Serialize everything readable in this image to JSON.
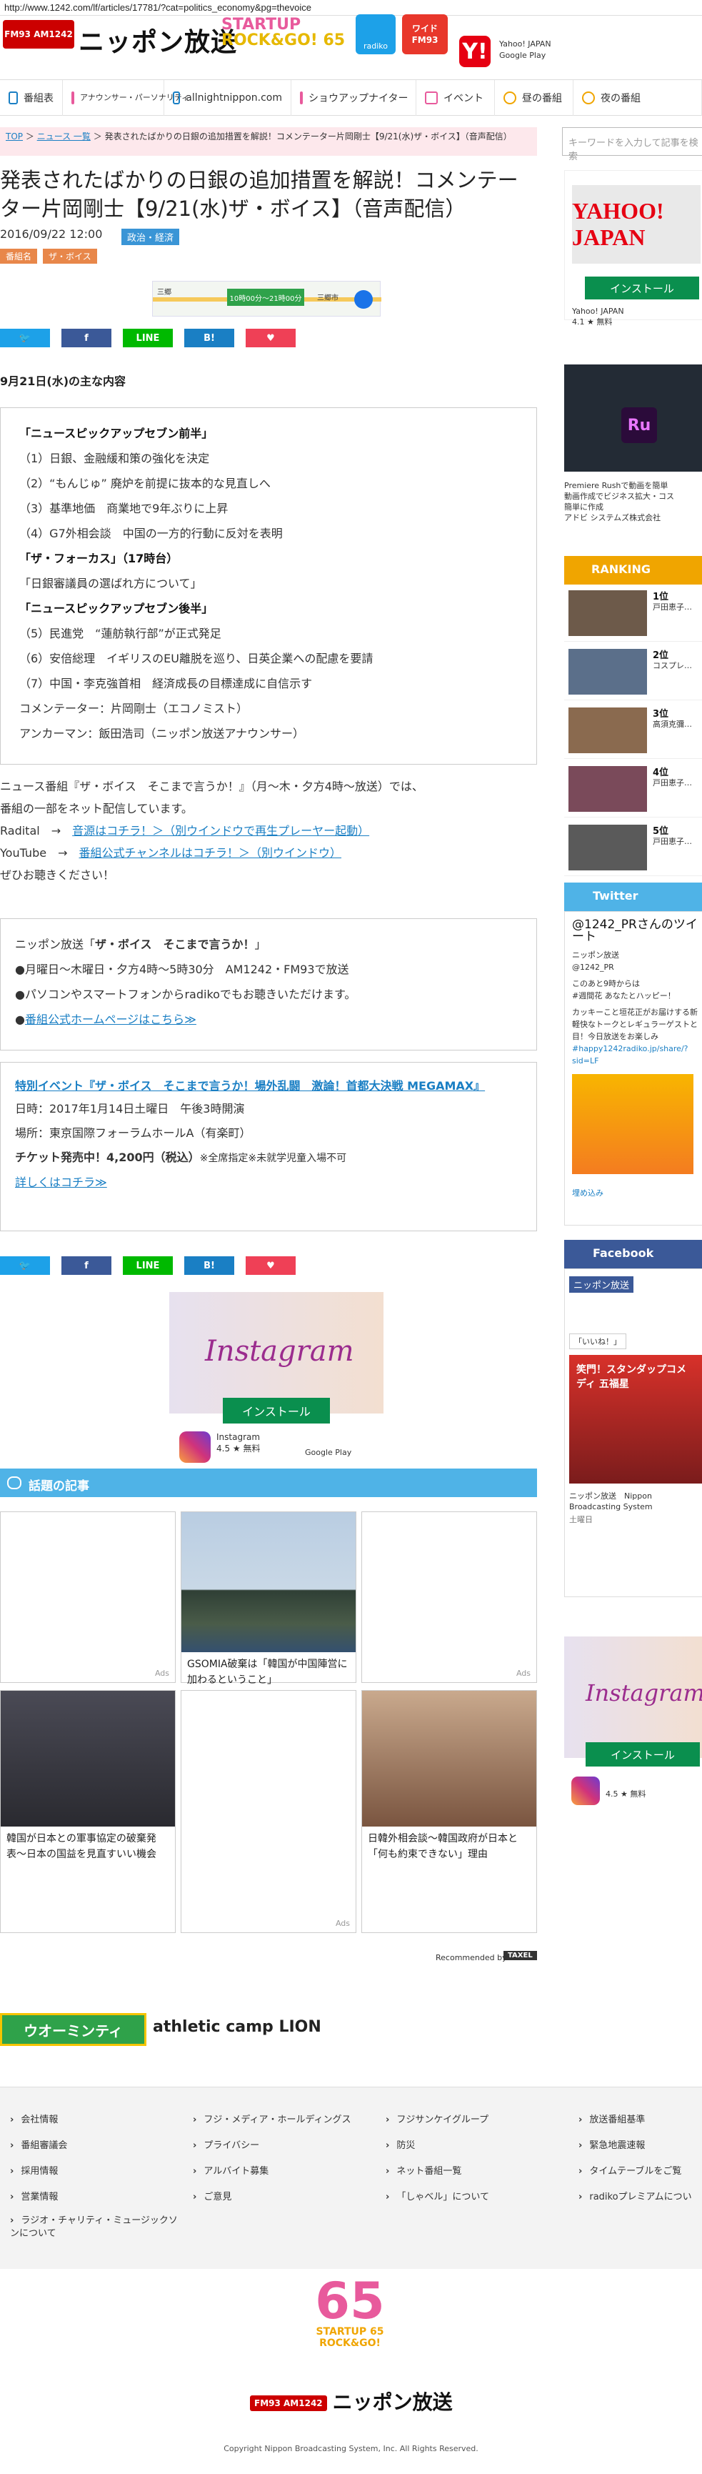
{
  "url": "http://www.1242.com/lf/articles/17781/?cat=politics_economy&pg=thevoice",
  "header": {
    "logo_mark": "FM93 AM1242",
    "logo_text": "ニッポン放送",
    "startup_line1": "STARTUP",
    "startup_line2": "ROCK&GO! 65",
    "radiko_label": "radiko",
    "wide_line1": "ワイド",
    "wide_line2": "FM93",
    "yahoo_app": "Yahoo! JAPAN",
    "yahoo_store": "Google Play",
    "yahoo_icon": "Y!"
  },
  "nav": [
    {
      "label": "番組表"
    },
    {
      "label": "アナウンサー・パーソナリティ"
    },
    {
      "label": "allnightnippon.com"
    },
    {
      "label": "ショウアップナイター"
    },
    {
      "label": "イベント"
    },
    {
      "label": "昼の番組"
    },
    {
      "label": "夜の番組"
    }
  ],
  "breadcrumb": {
    "top": "TOP",
    "sep": "＞",
    "news": "ニュース 一覧",
    "current": "発表されたばかりの日銀の追加措置を解説！コメンテーター片岡剛士【9/21(水)ザ・ボイス】（音声配信）"
  },
  "search": {
    "placeholder": "キーワードを入力して記事を検索"
  },
  "article": {
    "title": "発表されたばかりの日銀の追加措置を解説！コメンテーター片岡剛士【9/21(水)ザ・ボイス】（音声配信）",
    "date": "2016/09/22 12:00",
    "category": "政治・経済",
    "tag_label": "番組名",
    "tag_value": "ザ・ボイス",
    "map_ad_text": "10時00分〜21時00分",
    "map_ad_place1": "三郷",
    "map_ad_place2": "三郷市"
  },
  "share": {
    "twitter": "🐦",
    "facebook": "f",
    "line": "LINE",
    "hatena": "B!",
    "pocket": "♥"
  },
  "content": {
    "heading": "9月21日(水)の主な内容",
    "lines": [
      {
        "text": "「ニュースピックアップセブン前半」",
        "bold": true
      },
      {
        "text": "（1）日銀、金融緩和策の強化を決定",
        "bold": false
      },
      {
        "text": "（2）“もんじゅ” 廃炉を前提に抜本的な見直しへ",
        "bold": false
      },
      {
        "text": "（3）基準地価　商業地で9年ぶりに上昇",
        "bold": false
      },
      {
        "text": "（4）G7外相会談　中国の一方的行動に反対を表明",
        "bold": false
      },
      {
        "text": "「ザ・フォーカス」（17時台）",
        "bold": true
      },
      {
        "text": "「日銀審議員の選ばれ方について」",
        "bold": false
      },
      {
        "text": "「ニュースピックアップセブン後半」",
        "bold": true
      },
      {
        "text": "（5）民進党　“蓮舫執行部”が正式発足",
        "bold": false
      },
      {
        "text": "（6）安倍総理　イギリスのEU離脱を巡り、日英企業への配慮を要請",
        "bold": false
      },
      {
        "text": "（7）中国・李克強首相　経済成長の目標達成に自信示す",
        "bold": false
      },
      {
        "text": "コメンテーター：片岡剛士（エコノミスト）",
        "bold": false
      },
      {
        "text": "アンカーマン：飯田浩司（ニッポン放送アナウンサー）",
        "bold": false
      }
    ]
  },
  "description": {
    "line1": "ニュース番組『ザ・ボイス　そこまで言うか！』（月〜木・夕方4時〜放送）では、",
    "line2": "番組の一部をネット配信しています。",
    "radital_label": "Radital　→　",
    "radital_link": "音源はコチラ！＞（別ウインドウで再生プレーヤー起動）",
    "youtube_label": "YouTube　→　",
    "youtube_link": "番組公式チャンネルはコチラ！＞（別ウインドウ）",
    "closing": "ぜひお聴きください！"
  },
  "program_box": {
    "line1_prefix": "ニッポン放送「",
    "line1_bold": "ザ・ボイス　そこまで言うか！",
    "line1_suffix": "」",
    "line2": "●月曜日〜木曜日・夕方4時〜5時30分　AM1242・FM93で放送",
    "line3": "●パソコンやスマートフォンからradikoでもお聴きいただけます。",
    "line4_prefix": "●",
    "line4_link": "番組公式ホームページはこちら≫"
  },
  "event_box": {
    "title": "特別イベント『ザ・ボイス　そこまで言うか！場外乱闘　激論！首都大決戦 MEGAMAX』",
    "date": "日時：2017年1月14日土曜日　午後3時開演",
    "place": "場所：東京国際フォーラムホールA（有楽町）",
    "ticket_bold": "チケット発売中！4,200円（税込）",
    "ticket_rest": "※全席指定※未就学児童入場不可",
    "link": "詳しくはコチラ≫"
  },
  "insta_ad": {
    "logo": "Instagram",
    "install": "インストール",
    "name": "Instagram",
    "rating": "4.5 ★ 無料",
    "store": "Google Play"
  },
  "related": {
    "heading": "話題の記事",
    "cards": [
      {
        "caption": "",
        "ads": "Ads"
      },
      {
        "caption": "GSOMIA破棄は「韓国が中国陣営に加わるということ」",
        "ads": ""
      },
      {
        "caption": "",
        "ads": "Ads"
      },
      {
        "caption": "韓国が日本との軍事協定の破棄発表〜日本の国益を見直すいい機会",
        "ads": ""
      },
      {
        "caption": "",
        "ads": "Ads"
      },
      {
        "caption": "日韓外相会談〜韓国政府が日本と「何も約束できない」理由",
        "ads": ""
      }
    ],
    "recommended_by": "Recommended by",
    "taxel": "TAXEL"
  },
  "footer_banners": {
    "banner1": "ウオーミンティ",
    "banner2": "athletic camp LION"
  },
  "footer_links": {
    "col1": [
      "会社情報",
      "番組審議会",
      "採用情報",
      "営業情報",
      "ラジオ・チャリティ・ミュージックソンについて"
    ],
    "col2": [
      "フジ・メディア・ホールディングス",
      "プライバシー",
      "アルバイト募集",
      "ご意見"
    ],
    "col3": [
      "フジサンケイグループ",
      "防災",
      "ネット番組一覧",
      "「しゃべル」について"
    ],
    "col4": [
      "放送番組基準",
      "緊急地震速報",
      "タイムテーブルをご覧",
      "radikoプレミアムについ"
    ]
  },
  "bottom": {
    "logo_num": "65",
    "logo_sub1": "STARTUP 65",
    "logo_sub2": "ROCK&GO!",
    "brand_mark": "FM93 AM1242",
    "brand_text": "ニッポン放送",
    "copyright": "Copyright Nippon Broadcasting System, Inc. All Rights Reserved."
  },
  "sidebar": {
    "ad1_logo": "YAHOO! JAPAN",
    "ad1_install": "インストール",
    "ad1_name": "Yahoo! JAPAN",
    "ad1_rating": "4.1 ★ 無料",
    "ad2_title": "Premiere Rushで動画を簡単",
    "ad2_line2": "動画作成でビジネス拡大・コス",
    "ad2_line3": "簡単に作成",
    "ad2_company": "アドビ システムズ株式会社",
    "ad2_icon": "Ru",
    "ranking_head": "RANKING",
    "ranking": [
      {
        "num": "1位",
        "text": "戸田恵子…"
      },
      {
        "num": "2位",
        "text": "コスプレ…"
      },
      {
        "num": "3位",
        "text": "高須克彌…"
      },
      {
        "num": "4位",
        "text": "戸田恵子…"
      },
      {
        "num": "5位",
        "text": "戸田恵子…"
      }
    ],
    "twitter_head": "Twitter",
    "tw_title": "@1242_PRさんのツイート",
    "tw_account": "ニッポン放送",
    "tw_handle": "@1242_PR",
    "tw_line1": "このあと9時からは",
    "tw_line2": "#週間花 あなたとハッピー！",
    "tw_line3": "カッキーこと垣花正がお届けする新",
    "tw_line4": "軽快なトークとレギュラーゲストと",
    "tw_line5": "目！今日放送をお楽しみ",
    "tw_hashtag": "#happy1242radiko.jp/share/?sid=LF",
    "tw_embed": "埋め込み",
    "fb_head": "Facebook",
    "fb_page": "ニッポン放送",
    "fb_likes": "「いいね！」",
    "fb_post_name": "ニッポン放送　Nippon Broadcasting System",
    "fb_post_date": "土曜日",
    "fb_banner": "笑門！スタンダップコメディ 五福星",
    "ad3_logo": "Instagram",
    "ad3_install": "インストール",
    "ad3_rating": "4.5 ★ 無料"
  }
}
